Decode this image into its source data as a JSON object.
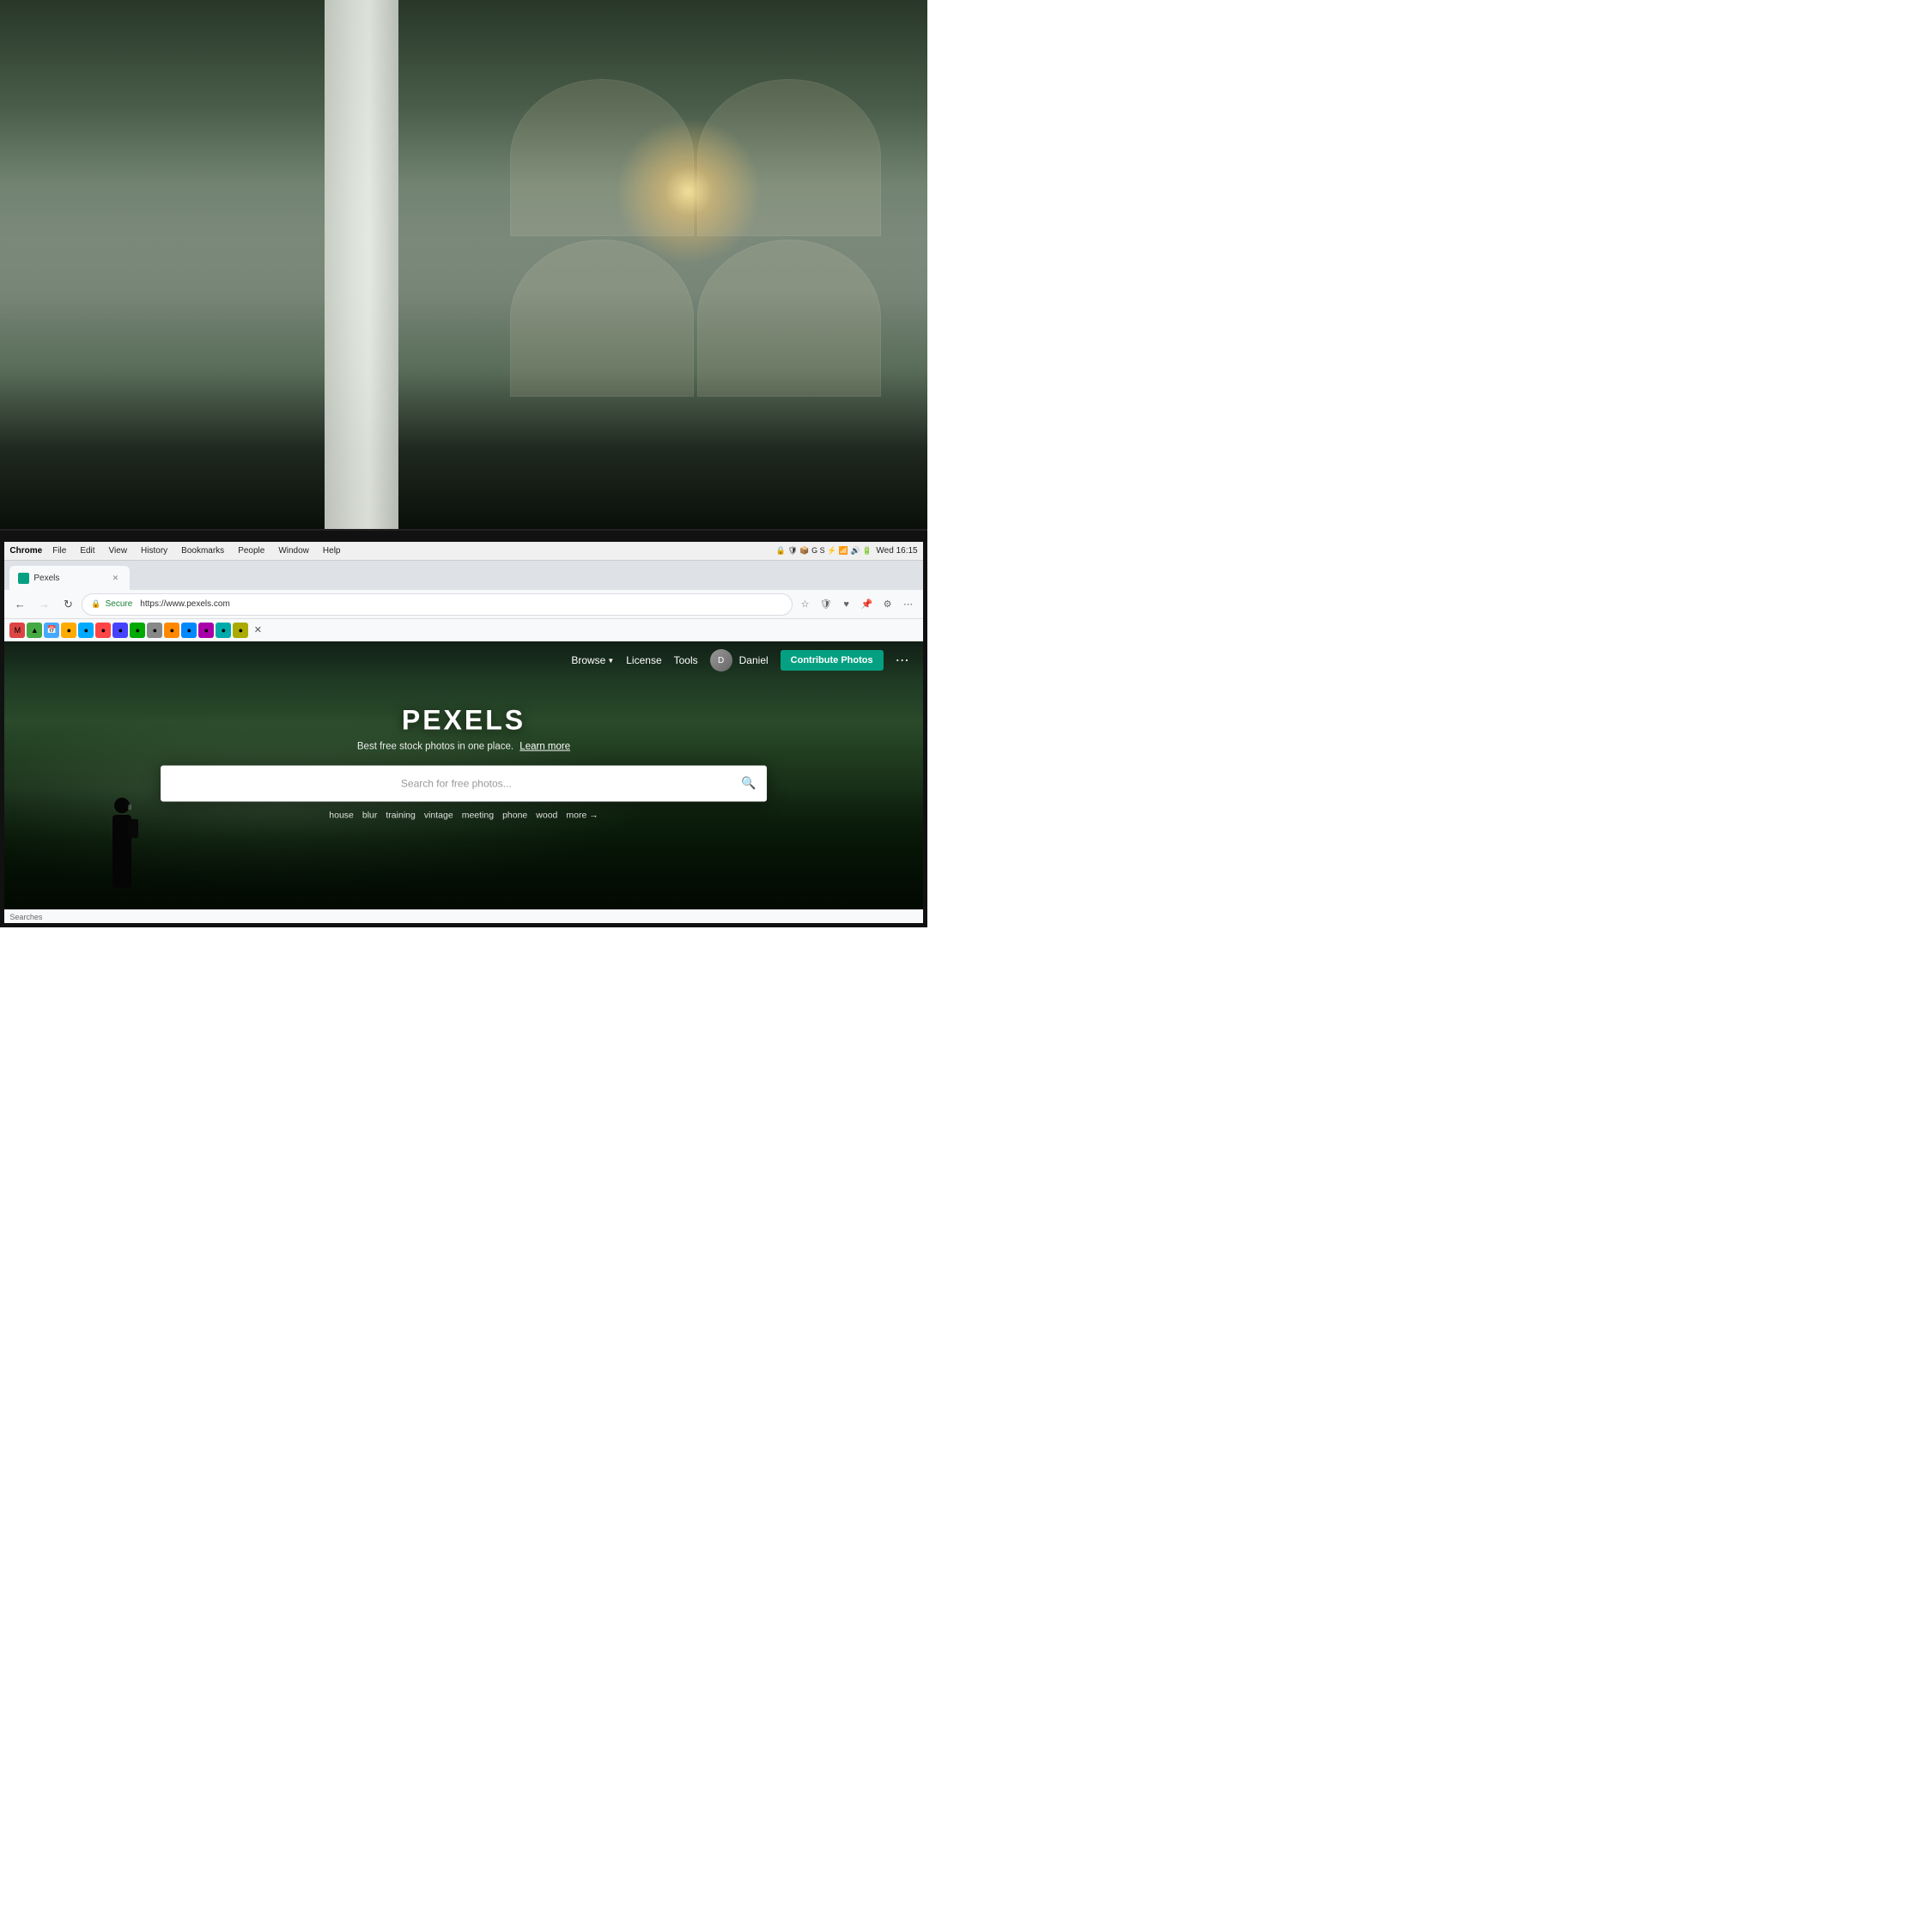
{
  "page": {
    "dimensions": "1080x1080"
  },
  "background_photo": {
    "description": "Office interior with plants, pillar, chairs, blurred background with light burst through windows"
  },
  "os_menubar": {
    "app_name": "Chrome",
    "menu_items": [
      "File",
      "Edit",
      "View",
      "History",
      "Bookmarks",
      "People",
      "Window",
      "Help"
    ],
    "time": "Wed 16:15",
    "battery": "100 %"
  },
  "browser": {
    "tab_title": "Pexels",
    "tab_favicon": "green",
    "url": "https://www.pexels.com",
    "secure_label": "Secure",
    "nav_buttons": {
      "back": "←",
      "forward": "→",
      "refresh": "↻"
    }
  },
  "pexels": {
    "site_title": "PEXELS",
    "tagline": "Best free stock photos in one place.",
    "tagline_link": "Learn more",
    "search_placeholder": "Search for free photos...",
    "suggestions": [
      "house",
      "blur",
      "training",
      "vintage",
      "meeting",
      "phone",
      "wood"
    ],
    "more_label": "more →",
    "nav": {
      "browse": "Browse",
      "license": "License",
      "tools": "Tools",
      "user_name": "Daniel",
      "contribute_btn": "Contribute Photos",
      "more": "⋯"
    }
  }
}
